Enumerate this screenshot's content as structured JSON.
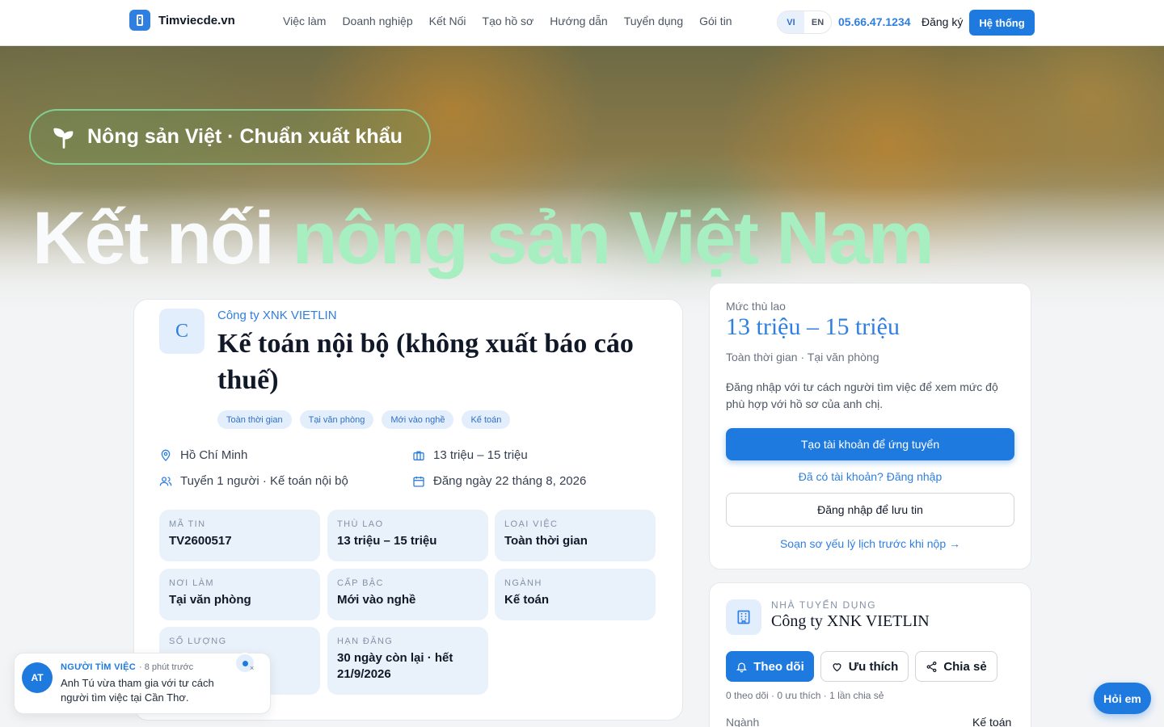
{
  "header": {
    "brand": "Timviecde.vn",
    "nav": [
      "Việc làm",
      "Doanh nghiệp",
      "Kết Nối",
      "Tạo hồ sơ",
      "Hướng dẫn",
      "Tuyển dụng",
      "Gói tin"
    ],
    "lang": {
      "vi": "VI",
      "en": "EN",
      "active": "VI"
    },
    "phone": "05.66.47.1234",
    "register": "Đăng ký",
    "system": "Hệ thống"
  },
  "hero": {
    "badge": "Nông sản Việt · Chuẩn xuất khẩu",
    "headline_white": "Kết nối ",
    "headline_green": "nông sản Việt Nam"
  },
  "job": {
    "avatar_letter": "C",
    "company": "Công ty XNK VIETLIN",
    "title": "Kế toán nội bộ (không xuất báo cáo thuế)",
    "tags": [
      "Toàn thời gian",
      "Tại văn phòng",
      "Mới vào nghề",
      "Kế toán"
    ],
    "meta": {
      "location": "Hồ Chí Minh",
      "salary": "13 triệu – 15 triệu",
      "hiring": "Tuyển 1 người · Kế toán nội bộ",
      "posted": "Đăng ngày 22 tháng 8, 2026"
    },
    "info": [
      {
        "label": "Mã tin",
        "value": "TV2600517"
      },
      {
        "label": "Thù lao",
        "value": "13 triệu – 15 triệu"
      },
      {
        "label": "Loại việc",
        "value": "Toàn thời gian"
      },
      {
        "label": "Nơi làm",
        "value": "Tại văn phòng"
      },
      {
        "label": "Cấp bậc",
        "value": "Mới vào nghề"
      },
      {
        "label": "Ngành",
        "value": "Kế toán"
      },
      {
        "label": "Số lượng",
        "value": ""
      },
      {
        "label": "Hạn đăng",
        "value": "30 ngày còn lại · hết 21/9/2026"
      }
    ]
  },
  "salary_card": {
    "label": "Mức thù lao",
    "value": "13 triệu – 15 triệu",
    "type": "Toàn thời gian · Tại văn phòng",
    "note": "Đăng nhập với tư cách người tìm việc để xem mức độ phù hợp với hồ sơ của anh chị.",
    "primary_btn": "Tạo tài khoản để ứng tuyển",
    "login_link": "Đã có tài khoản? Đăng nhập",
    "save_btn": "Đăng nhập để lưu tin",
    "cv_link": "Soạn sơ yếu lý lịch trước khi nộp →"
  },
  "employer": {
    "label": "NHÀ TUYỂN DỤNG",
    "name": "Công ty XNK VIETLIN",
    "follow": "Theo dõi",
    "like": "Ưu thích",
    "share": "Chia sẻ",
    "stats": "0 theo dõi · 0 ưu thích · 1 lần chia sẻ",
    "industry_label": "Ngành",
    "industry_value": "Kế toán"
  },
  "toast": {
    "avatar": "AT",
    "role": "NGƯỜI TÌM VIỆC",
    "time": "· 8 phút trước",
    "message": "Anh Tú vừa tham gia với tư cách người tìm việc tại Cần Thơ.",
    "close": "×"
  },
  "chat": "Hỏi em",
  "colors": {
    "accent": "#1f7ae0",
    "hero_green": "#a7efc1"
  }
}
